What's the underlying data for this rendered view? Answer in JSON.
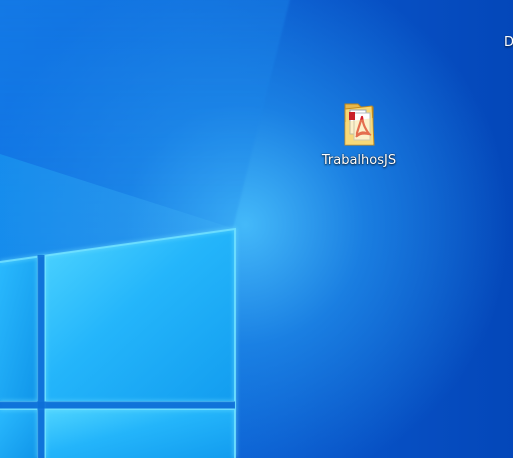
{
  "desktop": {
    "wallpaper_icon": "windows-logo-light-wallpaper",
    "colors": {
      "background": "#0b63d8",
      "glow": "#4cc6ff",
      "window_pane": "#20aef8",
      "label": "#ffffff"
    },
    "icons": [
      {
        "label": "TrabalhosJS",
        "icon": "folder-pdf-icon"
      }
    ],
    "edge_label": "D"
  }
}
